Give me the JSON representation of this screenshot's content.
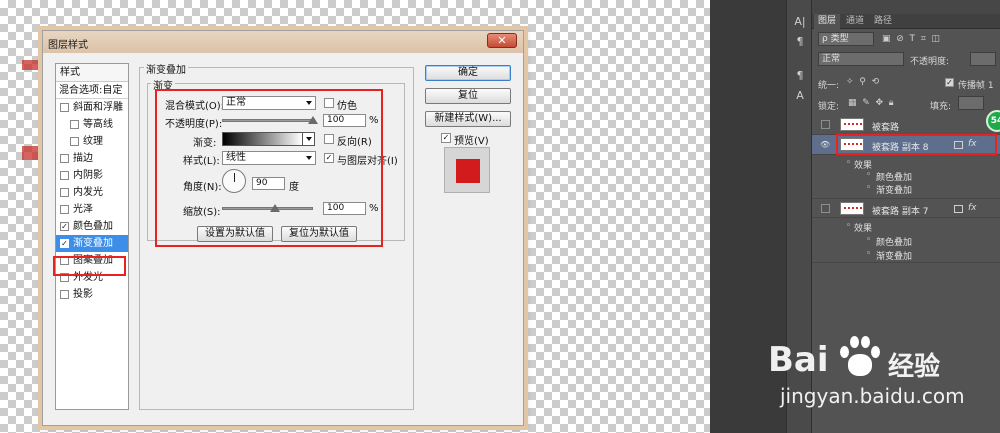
{
  "dialog": {
    "title": "图层样式",
    "close_label": "✕",
    "style_list": {
      "header": "样式",
      "blend_options": "混合选项:自定",
      "items": [
        {
          "label": "斜面和浮雕",
          "checked": false,
          "indent": 0
        },
        {
          "label": "等高线",
          "checked": false,
          "indent": 1
        },
        {
          "label": "纹理",
          "checked": false,
          "indent": 1
        },
        {
          "label": "描边",
          "checked": false,
          "indent": 0
        },
        {
          "label": "内阴影",
          "checked": false,
          "indent": 0
        },
        {
          "label": "内发光",
          "checked": false,
          "indent": 0
        },
        {
          "label": "光泽",
          "checked": false,
          "indent": 0
        },
        {
          "label": "颜色叠加",
          "checked": true,
          "indent": 0
        },
        {
          "label": "渐变叠加",
          "checked": true,
          "indent": 0,
          "selected": true
        },
        {
          "label": "图案叠加",
          "checked": false,
          "indent": 0
        },
        {
          "label": "外发光",
          "checked": false,
          "indent": 0
        },
        {
          "label": "投影",
          "checked": false,
          "indent": 0
        }
      ]
    },
    "section_title": "渐变叠加",
    "group_title": "渐变",
    "blend_mode_label": "混合模式(O):",
    "blend_mode_value": "正常",
    "dither_label": "仿色",
    "opacity_label": "不透明度(P):",
    "opacity_value": "100",
    "opacity_unit": "%",
    "gradient_label": "渐变:",
    "reverse_label": "反向(R)",
    "style_label": "样式(L):",
    "style_value": "线性",
    "align_label": "与图层对齐(I)",
    "angle_label": "角度(N):",
    "angle_value": "90",
    "angle_unit": "度",
    "scale_label": "缩放(S):",
    "scale_value": "100",
    "scale_unit": "%",
    "make_default_label": "设置为默认值",
    "reset_default_label": "复位为默认值",
    "ok_label": "确定",
    "reset_label": "复位",
    "new_style_label": "新建样式(W)...",
    "preview_label": "预览(V)",
    "preview_color": "#d21b1c"
  },
  "layers_panel": {
    "tabs": [
      "图层",
      "通道",
      "路径"
    ],
    "filter_kind": "类型",
    "blend_mode": "正常",
    "opacity_label": "不透明度:",
    "unify_label": "统一:",
    "propagate_label": "传播帧 1",
    "lock_label": "锁定:",
    "fill_label": "填充:",
    "badge": "54",
    "layers": [
      {
        "name": "被套路",
        "visible": false,
        "fx": false,
        "selected": false
      },
      {
        "name": "被套路 副本 8",
        "visible": true,
        "fx": true,
        "selected": true,
        "effects_label": "效果",
        "effects": [
          "颜色叠加",
          "渐变叠加"
        ]
      },
      {
        "name": "被套路 副本 7",
        "visible": false,
        "fx": true,
        "selected": false,
        "effects_label": "效果",
        "effects": [
          "颜色叠加",
          "渐变叠加"
        ]
      }
    ],
    "fx_label": "fx"
  },
  "watermark": {
    "brand": "Bai",
    "brand_tail": "du",
    "brand_cn": "经验",
    "url": "jingyan.baidu.com"
  },
  "colors": {
    "accent_blue": "#3c8ee8",
    "highlight_red": "#e8231f",
    "panel_dark": "#535353"
  }
}
